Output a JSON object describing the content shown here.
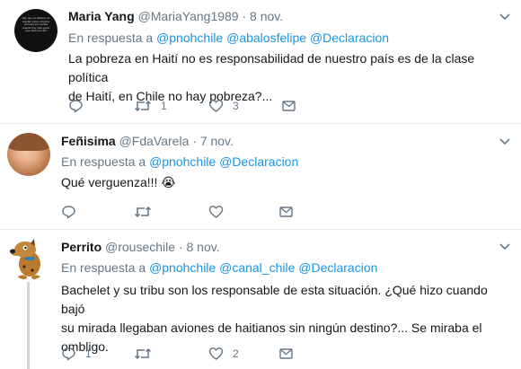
{
  "tweets": [
    {
      "name": "Maria Yang",
      "handle": "@MariaYang1989",
      "dot": "·",
      "date": "8 nov.",
      "reply_prefix": "En respuesta a",
      "mentions": [
        "@pnohchile",
        "@abalosfelipe",
        "@Declaracion"
      ],
      "text_line1": "La pobreza en Haití no es responsabilidad de nuestro país es de  la clase política",
      "text_line2": "de Haití,  en Chile  no hay pobreza?...",
      "retweets": "1",
      "likes": "3",
      "avatar_text": "Hay que no debiese de quedar nunca ninguna persona sin comida cuando hay más gente que están por ahí"
    },
    {
      "name": "Feñisima",
      "handle": "@FdaVarela",
      "dot": "·",
      "date": "7 nov.",
      "reply_prefix": "En respuesta a",
      "mentions": [
        "@pnohchile",
        "@Declaracion"
      ],
      "text": "Qué verguenza!!!",
      "emoji": "😭"
    },
    {
      "name": "Perrito",
      "handle": "@rousechile",
      "dot": "·",
      "date": "8 nov.",
      "reply_prefix": "En respuesta a",
      "mentions": [
        "@pnohchile",
        "@canal_chile",
        "@Declaracion"
      ],
      "text_line1": "Bachelet y su tribu son los responsable de esta situación. ¿Qué hizo cuando bajó",
      "text_line2": "su mirada llegaban aviones de haitianos sin ningún destino?... Se miraba el",
      "text_line3": "ombligo.",
      "replies": "1",
      "likes": "2"
    }
  ],
  "colors": {
    "link": "#1b95e0",
    "muted": "#657786",
    "border": "#e6ecf0"
  }
}
